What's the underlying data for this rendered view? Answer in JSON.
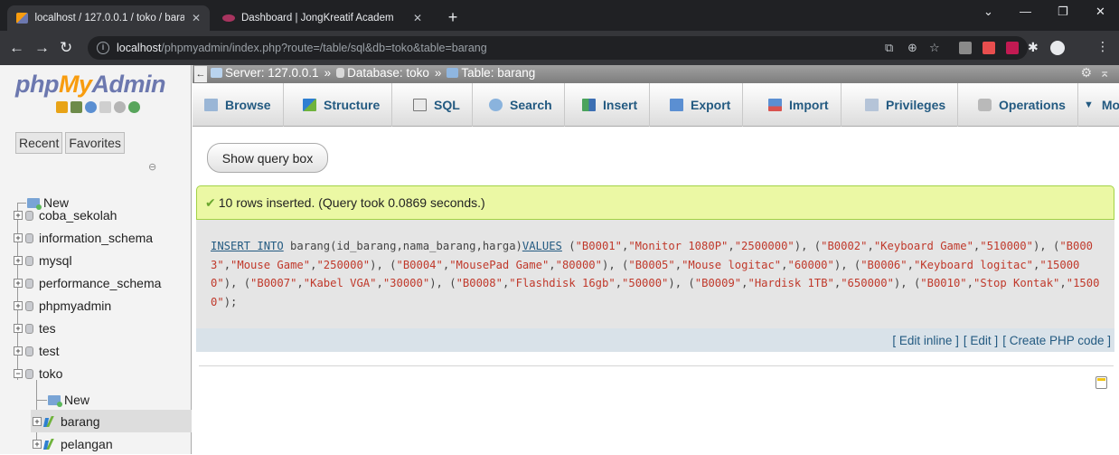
{
  "browser": {
    "tabs": [
      {
        "title": "localhost / 127.0.0.1 / toko / bara",
        "active": true
      },
      {
        "title": "Dashboard | JongKreatif Academ",
        "active": false
      }
    ],
    "url_host": "localhost",
    "url_path": "/phpmyadmin/index.php?route=/table/sql&db=toko&table=barang"
  },
  "nav": {
    "logo": {
      "php": "php",
      "my": "My",
      "admin": "Admin"
    },
    "tabs": [
      "Recent",
      "Favorites"
    ],
    "tree": {
      "new": "New",
      "databases": [
        "coba_sekolah",
        "information_schema",
        "mysql",
        "performance_schema",
        "phpmyadmin",
        "tes",
        "test",
        "toko"
      ],
      "toko_new": "New",
      "tables": [
        "barang",
        "pelangan"
      ]
    }
  },
  "breadcrumb": {
    "server": "Server: 127.0.0.1",
    "database": "Database: toko",
    "table": "Table: barang"
  },
  "menu": [
    "Browse",
    "Structure",
    "SQL",
    "Search",
    "Insert",
    "Export",
    "Import",
    "Privileges",
    "Operations",
    "Mo"
  ],
  "show_query_label": "Show query box",
  "success_message": "10 rows inserted. (Query took 0.0869 seconds.)",
  "sql": {
    "kw_insert": "INSERT INTO",
    "head": " barang(id_barang,nama_barang,harga)",
    "kw_values": "VALUES",
    "rows": [
      [
        "B0001",
        "Monitor 1080P",
        "2500000"
      ],
      [
        "B0002",
        "Keyboard Game",
        "510000"
      ],
      [
        "B0003",
        "Mouse Game",
        "250000"
      ],
      [
        "B0004",
        "MousePad Game",
        "80000"
      ],
      [
        "B0005",
        "Mouse logitac",
        "60000"
      ],
      [
        "B0006",
        "Keyboard logitac",
        "150000"
      ],
      [
        "B0007",
        "Kabel VGA",
        "30000"
      ],
      [
        "B0008",
        "Flashdisk 16gb",
        "50000"
      ],
      [
        "B0009",
        "Hardisk 1TB",
        "650000"
      ],
      [
        "B0010",
        "Stop Kontak",
        "15000"
      ]
    ]
  },
  "sql_links": [
    "[ Edit inline ]",
    "[ Edit ]",
    "[ Create PHP code ]"
  ],
  "colors": {
    "success_bg": "#ebf8a4",
    "link": "#235a81",
    "logo_blue": "#6c78af",
    "logo_orange": "#f89c0e"
  }
}
